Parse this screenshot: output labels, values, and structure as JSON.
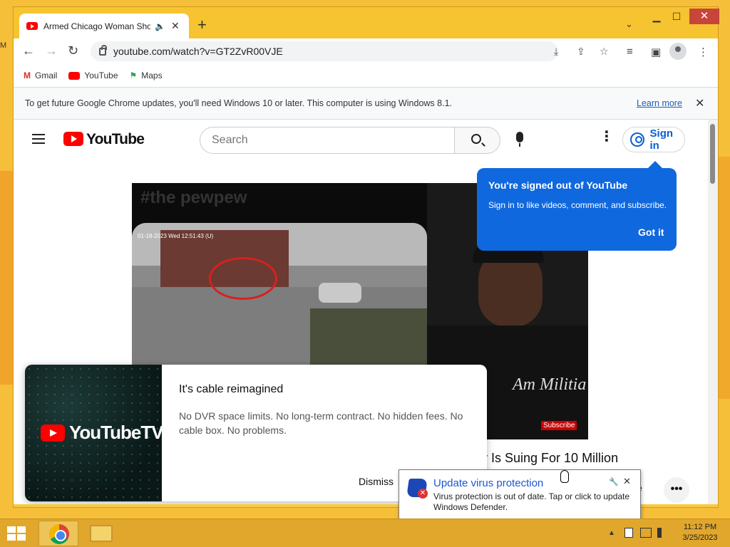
{
  "desktop": {
    "edge_text": "M"
  },
  "browser": {
    "tab": {
      "title": "Armed Chicago Woman Sho",
      "audio_icon": "speaker-icon",
      "close": "✕"
    },
    "new_tab": "+",
    "tab_list": "⌄",
    "window_controls": {
      "minimize": "▁",
      "maximize": "☐",
      "close": "✕"
    },
    "nav": {
      "back": "←",
      "forward": "→",
      "reload": "↻"
    },
    "url": "youtube.com/watch?v=GT2ZvR00VJE",
    "omnibox_icons": {
      "install": "⤓",
      "share": "⇪",
      "bookmark": "☆"
    },
    "toolbar_icons": {
      "reading_list": "≡",
      "side_panel": "▣",
      "menu": "⋮"
    },
    "bookmarks": [
      {
        "label": "Gmail",
        "icon": "M"
      },
      {
        "label": "YouTube"
      },
      {
        "label": "Maps",
        "icon": "⚑"
      }
    ],
    "infobar": {
      "text": "To get future Google Chrome updates, you'll need Windows 10 or later. This computer is using Windows 8.1.",
      "link": "Learn more",
      "close": "✕"
    }
  },
  "youtube": {
    "logo_text": "YouTube",
    "search_placeholder": "Search",
    "kebab": "⋮",
    "signin_label": "Sign in",
    "tooltip": {
      "title": "You're signed out of YouTube",
      "body": "Sign in to like videos, comment, and subscribe.",
      "button": "Got it"
    },
    "video": {
      "watermark": "#the pewpew",
      "cam_timestamp": "01-18-2023 Wed 12:51:43 (U)",
      "shirt_text": "Am Militia",
      "subscribe_mark": "Subscribe",
      "title_fragment": "y Is Suing For 10 Million",
      "share_fragment": "e",
      "more": "•••"
    },
    "ad": {
      "logo_text": "YouTubeTV",
      "title": "It's cable reimagined",
      "description": "No DVR space limits. No long-term contract. No hidden fees. No cable box. No problems.",
      "dismiss": "Dismiss"
    }
  },
  "notification": {
    "title": "Update virus protection",
    "body": "Virus protection is out of date. Tap or click to update Windows Defender.",
    "wrench": "🔧",
    "close": "✕",
    "badge": "✕"
  },
  "taskbar": {
    "tray_arrow": "▲",
    "clock_time": "11:12 PM",
    "clock_date": "3/25/2023"
  }
}
